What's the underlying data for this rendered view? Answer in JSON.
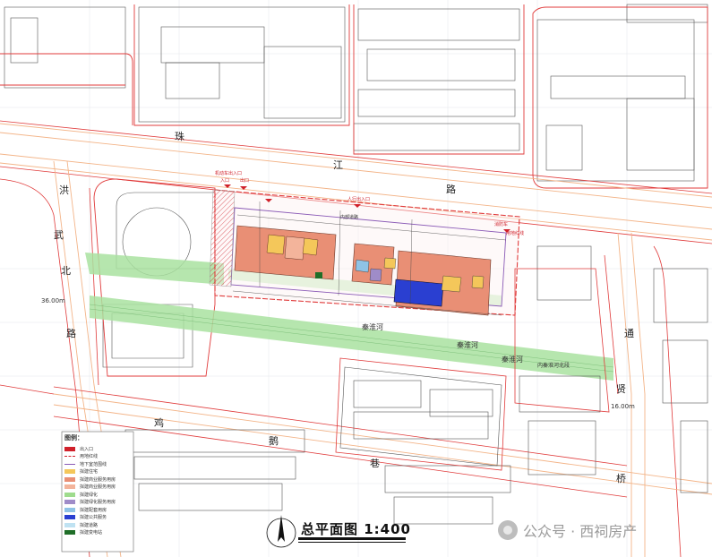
{
  "title": "总平面图 1:400",
  "watermark": "公众号 · 西祠房产",
  "roads": {
    "zhujiang": [
      "珠",
      "江",
      "路"
    ],
    "hongwu": [
      "洪",
      "武",
      "北",
      "路"
    ],
    "tongxian": [
      "通",
      "贤",
      "桥"
    ],
    "jie_e": [
      "鸡",
      "鹅",
      "巷"
    ],
    "hongwu_width": "36.00m",
    "tongxian_width": "16.00m"
  },
  "site_labels": {
    "entry_people": "人行出入口",
    "entry_vehicle_in": "入口",
    "entry_vehicle_out": "出口",
    "car_entry": "机动车出入口",
    "fire_entry": "消防车",
    "inner_road": "内部道路",
    "park": "内秦淮河北段",
    "red_line": "用地红线",
    "greenway": "秦淮河"
  },
  "legend": {
    "heading": "图例：",
    "items": [
      {
        "label": "出入口",
        "color": "#d0202a"
      },
      {
        "label": "用地红线",
        "color": "#d0202a"
      },
      {
        "label": "地下室范围线",
        "color": "#8a5ab6"
      },
      {
        "label": "拟建住宅",
        "color": "#f4c75a"
      },
      {
        "label": "拟建商业服务用房",
        "color": "#e98f75"
      },
      {
        "label": "拟建商业服务用房",
        "color": "#f3b49b"
      },
      {
        "label": "拟建绿化",
        "color": "#9fdc8e"
      },
      {
        "label": "拟建绿化服务用房",
        "color": "#9f8cc8"
      },
      {
        "label": "拟建配套用房",
        "color": "#8fc3e6"
      },
      {
        "label": "拟建公共服务",
        "color": "#2a3fd1"
      },
      {
        "label": "拟建道路",
        "color": "#bfe2f2"
      },
      {
        "label": "拟建变电站",
        "color": "#1f6e28"
      }
    ]
  },
  "colors": {
    "parcel_red": "#e03b3b",
    "road_orange": "#f3b488",
    "building_salmon": "#e98f75",
    "building_yellow": "#f4c75a",
    "green_strip": "#a9e2a0",
    "blue_building": "#2a3fd1",
    "purple_line": "#8a5ab6"
  }
}
